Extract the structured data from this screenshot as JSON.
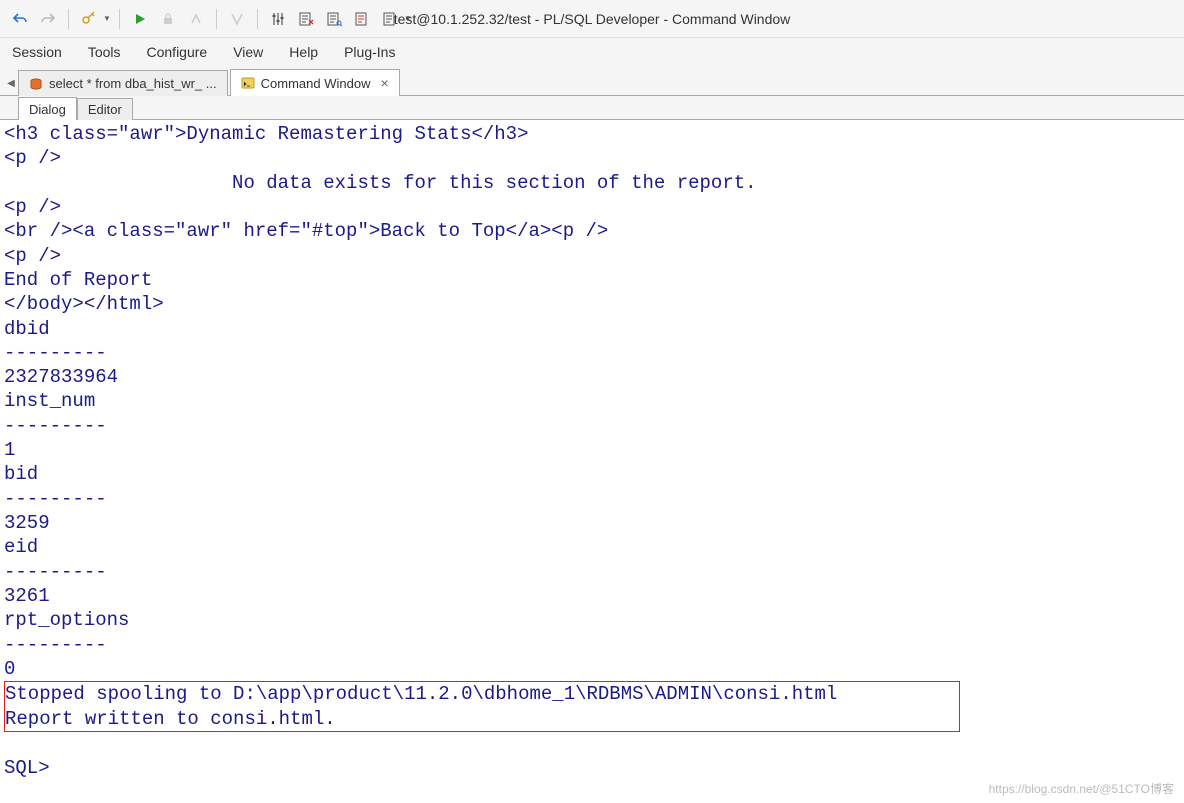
{
  "window": {
    "title": "test@10.1.252.32/test - PL/SQL Developer - Command Window"
  },
  "menubar": [
    "Session",
    "Tools",
    "Configure",
    "View",
    "Help",
    "Plug-Ins"
  ],
  "tabs": [
    {
      "label": "select * from dba_hist_wr_ ...",
      "active": false,
      "closable": false
    },
    {
      "label": "Command Window",
      "active": true,
      "closable": true
    }
  ],
  "subtabs": [
    {
      "label": "Dialog",
      "active": true
    },
    {
      "label": "Editor",
      "active": false
    }
  ],
  "console": {
    "lines": [
      "<h3 class=\"awr\">Dynamic Remastering Stats</h3>",
      "<p />",
      "                    No data exists for this section of the report.",
      "<p />",
      "<br /><a class=\"awr\" href=\"#top\">Back to Top</a><p />",
      "<p />",
      "End of Report",
      "</body></html>",
      "dbid",
      "---------",
      "2327833964",
      "inst_num",
      "---------",
      "1",
      "bid",
      "---------",
      "3259",
      "eid",
      "---------",
      "3261",
      "rpt_options",
      "---------",
      "0"
    ],
    "highlight": [
      "Stopped spooling to D:\\app\\product\\11.2.0\\dbhome_1\\RDBMS\\ADMIN\\consi.html",
      "Report written to consi.html."
    ],
    "prompt": "SQL>"
  },
  "watermark": "https://blog.csdn.net/@51CTO博客"
}
